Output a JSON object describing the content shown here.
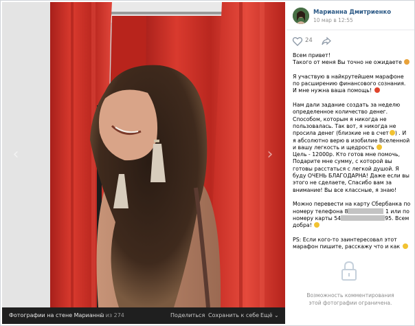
{
  "photo_footer": {
    "title": "Фотографии на стене Марианны",
    "counter": "1 из 274",
    "share": "Поделиться",
    "save": "Сохранить к себе",
    "more": "Ещё ⌄"
  },
  "post": {
    "author": "Марианна Дмитриенко",
    "date": "10 мар в 12:55",
    "likes": "24",
    "caption": [
      {
        "text": "Всем привет!\nТакого от меня Вы точно не ожидаете",
        "emoji": "#e8a23a"
      },
      {
        "text": "Я участвую в найкрутейшем марафоне по расширению финансового сознания. И мне нужна ваша помощь!",
        "emoji": "#e0452d"
      },
      {
        "text": "Нам дали задание создать за неделю определенное количество денег. Способом, которым я никогда не пользовалась. Так вот, я никогда не просила денег (близкие не в счет",
        "emoji": "#f1c232",
        "tail": ") . И я абсолютно верю в изобилие Вселенной и вашу легкость и щедрость",
        "tail_emoji": "#f1c232",
        "tail2": "\nЦель - 12000р. Кто готов мне помочь, Подарите мне сумму, с которой вы готовы расстаться с легкой душой. Я буду ОЧЕНЬ БЛАГОДАРНА! Даже если вы этого не сделаете, Спасибо вам за внимание! Вы все классные, я знаю!"
      },
      {
        "text": "Можно перевести на карту Сбербанка по номеру телефона 8",
        "redact1": "",
        "mid": " 1 или по номеру карты 54",
        "redact2": "",
        "end": "95. Всем добра!",
        "emoji": "#f1c232"
      },
      {
        "text": "PS: Если кого-то заинтересовал этот марафон пишите, расскажу что и как",
        "emoji": "#f1c232"
      }
    ],
    "comments_closed": "Возможность комментирования этой фотографии ограничена."
  },
  "icons": {
    "like": "heart-outline-icon",
    "share": "share-arrow-icon",
    "lock": "lock-icon",
    "prev": "chevron-left-icon",
    "next": "chevron-right-icon"
  },
  "colors": {
    "link": "#2a5885",
    "curtain": "#d8322a",
    "footer_bg": "#1f1f1f"
  }
}
